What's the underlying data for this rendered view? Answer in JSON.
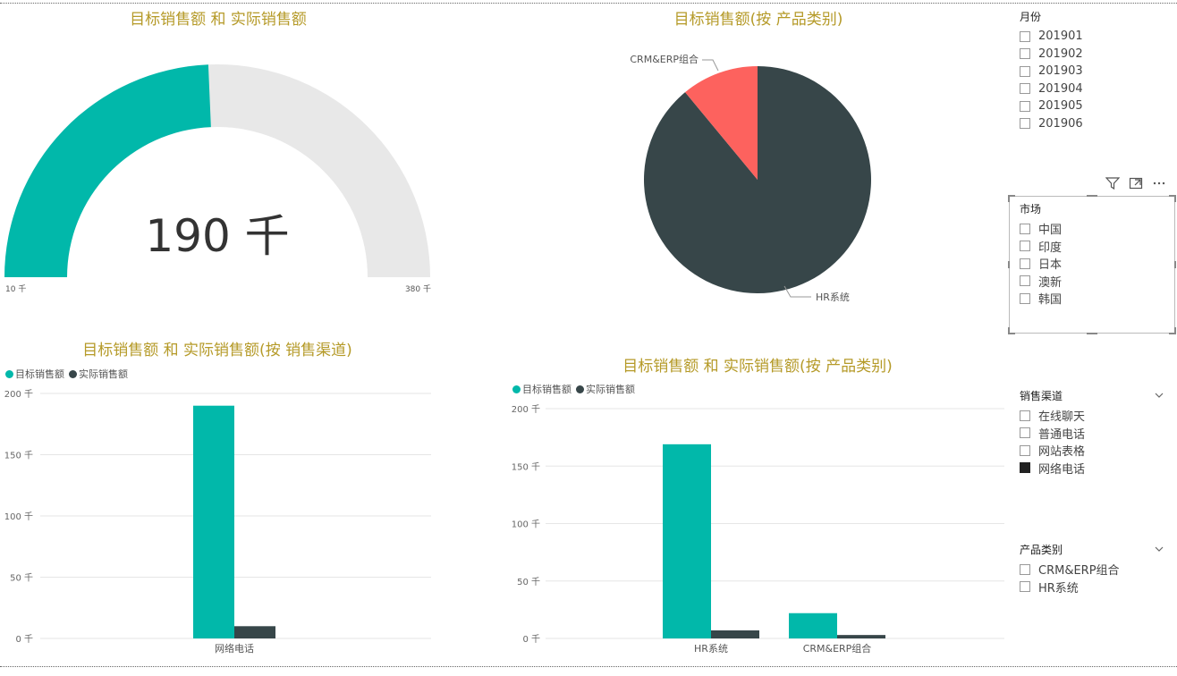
{
  "gauge": {
    "title": "目标销售额 和 实际销售额",
    "value_label": "190 千",
    "min_label": "10 千",
    "max_label": "380 千",
    "min": 10,
    "max": 380,
    "value": 190,
    "fill_color": "#01b8aa",
    "track_color": "#e8e8e8"
  },
  "chart_data": [
    {
      "type": "pie",
      "title": "目标销售额(按 产品类别)",
      "categories": [
        "HR系统",
        "CRM&ERP组合"
      ],
      "values": [
        89,
        11
      ],
      "colors": [
        "#374649",
        "#fd625e"
      ]
    },
    {
      "type": "bar",
      "title": "目标销售额 和 实际销售额(按 销售渠道)",
      "categories": [
        "网络电话"
      ],
      "series": [
        {
          "name": "目标销售额",
          "values": [
            190
          ],
          "color": "#01b8aa"
        },
        {
          "name": "实际销售额",
          "values": [
            10
          ],
          "color": "#374649"
        }
      ],
      "ylim": [
        0,
        200
      ],
      "yticks": [
        0,
        50,
        100,
        150,
        200
      ],
      "ytick_labels": [
        "0 千",
        "50 千",
        "100 千",
        "150 千",
        "200 千"
      ]
    },
    {
      "type": "bar",
      "title": "目标销售额 和 实际销售额(按 产品类别)",
      "categories": [
        "HR系统",
        "CRM&ERP组合"
      ],
      "series": [
        {
          "name": "目标销售额",
          "values": [
            169,
            22
          ],
          "color": "#01b8aa"
        },
        {
          "name": "实际销售额",
          "values": [
            7,
            3
          ],
          "color": "#374649"
        }
      ],
      "ylim": [
        0,
        200
      ],
      "yticks": [
        0,
        50,
        100,
        150,
        200
      ],
      "ytick_labels": [
        "0 千",
        "50 千",
        "100 千",
        "150 千",
        "200 千"
      ]
    }
  ],
  "slicers": {
    "month": {
      "title": "月份",
      "items": [
        {
          "label": "201901",
          "checked": false
        },
        {
          "label": "201902",
          "checked": false
        },
        {
          "label": "201903",
          "checked": false
        },
        {
          "label": "201904",
          "checked": false
        },
        {
          "label": "201905",
          "checked": false
        },
        {
          "label": "201906",
          "checked": false
        }
      ]
    },
    "market": {
      "title": "市场",
      "items": [
        {
          "label": "中国",
          "checked": false
        },
        {
          "label": "印度",
          "checked": false
        },
        {
          "label": "日本",
          "checked": false
        },
        {
          "label": "澳新",
          "checked": false
        },
        {
          "label": "韩国",
          "checked": false
        }
      ]
    },
    "channel": {
      "title": "销售渠道",
      "items": [
        {
          "label": "在线聊天",
          "checked": false
        },
        {
          "label": "普通电话",
          "checked": false
        },
        {
          "label": "网站表格",
          "checked": false
        },
        {
          "label": "网络电话",
          "checked": true
        }
      ]
    },
    "category": {
      "title": "产品类别",
      "items": [
        {
          "label": "CRM&ERP组合",
          "checked": false
        },
        {
          "label": "HR系统",
          "checked": false
        }
      ]
    }
  },
  "icons": {
    "filter": "filter-icon",
    "focus": "focus-mode-icon",
    "more": "more-options-icon"
  }
}
